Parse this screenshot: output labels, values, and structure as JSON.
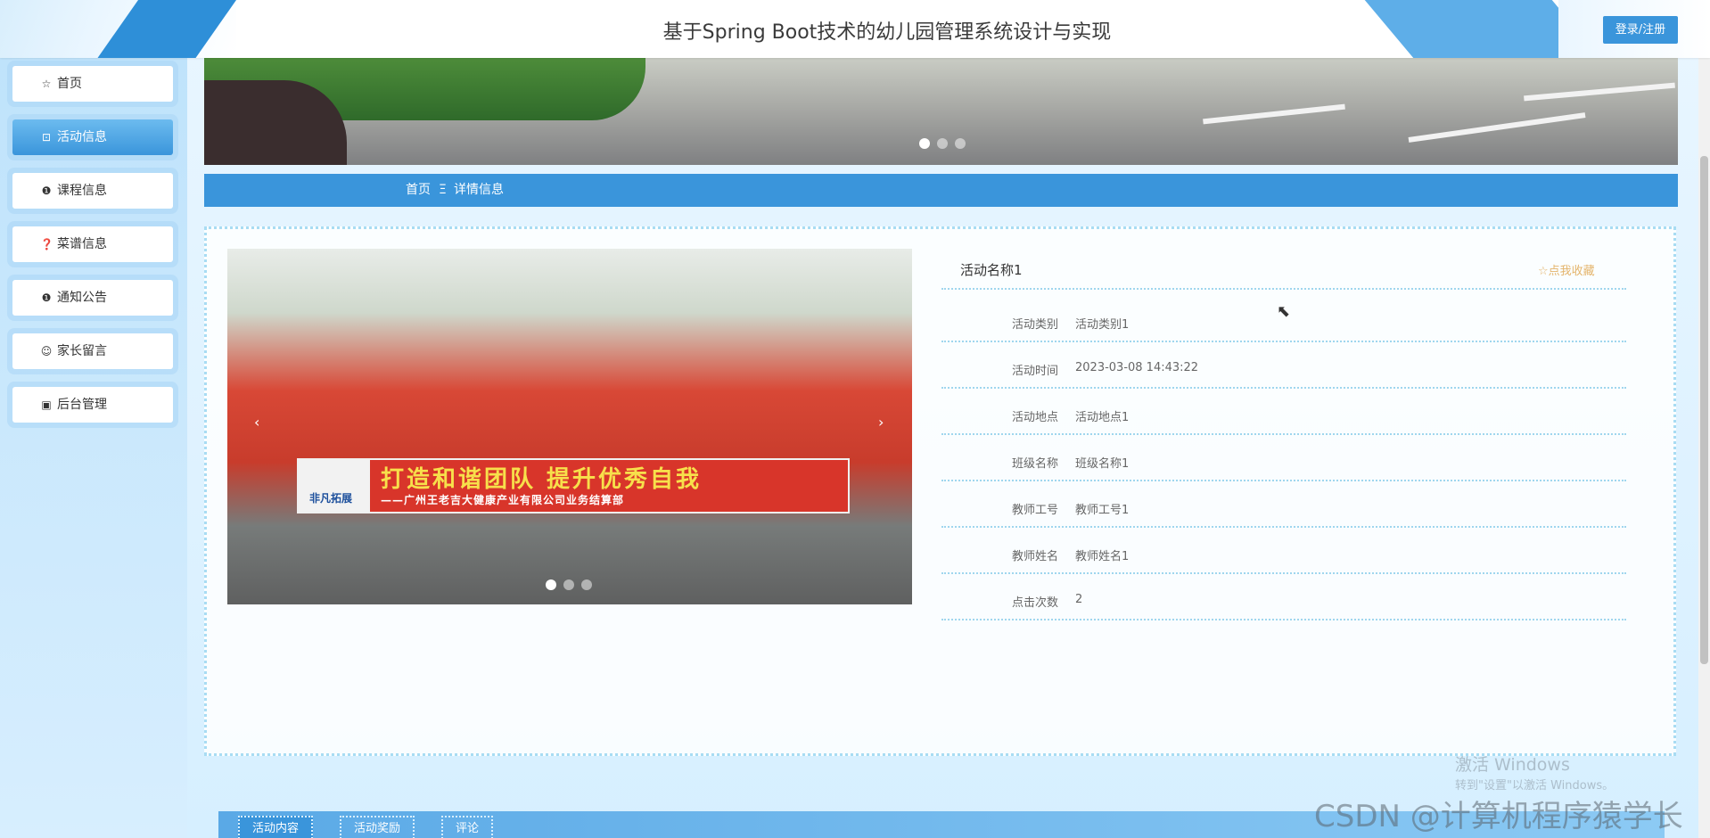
{
  "header": {
    "site_title": "基于Spring Boot技术的幼儿园管理系统设计与实现",
    "login_label": "登录/注册"
  },
  "sidebar": {
    "items": [
      {
        "label": "首页",
        "icon": "star-icon",
        "glyph": "☆"
      },
      {
        "label": "活动信息",
        "icon": "briefcase-icon",
        "glyph": "⊡"
      },
      {
        "label": "课程信息",
        "icon": "info-icon",
        "glyph": "❶"
      },
      {
        "label": "菜谱信息",
        "icon": "question-icon",
        "glyph": "❓"
      },
      {
        "label": "通知公告",
        "icon": "info-circle-icon",
        "glyph": "❶"
      },
      {
        "label": "家长留言",
        "icon": "smile-icon",
        "glyph": "☺"
      },
      {
        "label": "后台管理",
        "icon": "calendar-icon",
        "glyph": "▣"
      }
    ],
    "active_index": 1
  },
  "breadcrumb": {
    "home": "首页",
    "separator": "Ξ",
    "current": "详情信息"
  },
  "detail": {
    "title": "活动名称1",
    "favorite_label": "☆点我收藏",
    "photo_banner_text": "打造和谐团队  提升优秀自我",
    "photo_banner_sub": "——广州王老吉大健康产业有限公司业务结算部",
    "photo_logo_text": "非凡拓展",
    "fields": [
      {
        "label": "活动类别",
        "value": "活动类别1"
      },
      {
        "label": "活动时间",
        "value": "2023-03-08 14:43:22"
      },
      {
        "label": "活动地点",
        "value": "活动地点1"
      },
      {
        "label": "班级名称",
        "value": "班级名称1"
      },
      {
        "label": "教师工号",
        "value": "教师工号1"
      },
      {
        "label": "教师姓名",
        "value": "教师姓名1"
      },
      {
        "label": "点击次数",
        "value": "2"
      }
    ]
  },
  "tabs": [
    "活动内容",
    "活动奖励",
    "评论"
  ],
  "watermark": {
    "activate": "激活 Windows",
    "activate_hint": "转到\"设置\"以激活 Windows。",
    "csdn": "CSDN @计算机程序猿学长"
  },
  "colors": {
    "primary": "#3a95db",
    "favorite": "#e4b46b"
  }
}
